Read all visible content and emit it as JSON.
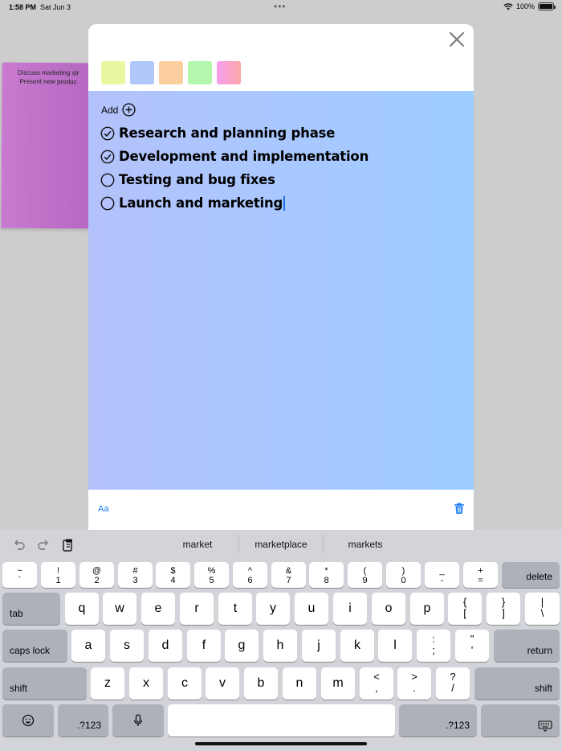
{
  "status_bar": {
    "time": "1:58 PM",
    "date": "Sat Jun 3",
    "battery": "100%"
  },
  "background_note": {
    "lines": [
      "Discuss marketing str",
      "Present new produc"
    ]
  },
  "modal": {
    "swatch_colors": [
      "#e9f8a0",
      "#b0c7fb",
      "#fccf9f",
      "#b5f7ae",
      "#f6a0f0"
    ],
    "add_label": "Add",
    "checklist": [
      {
        "text": "Research and planning phase",
        "checked": true
      },
      {
        "text": "Development and implementation",
        "checked": true
      },
      {
        "text": "Testing and bug fixes",
        "checked": false
      },
      {
        "text": "Launch and marketing",
        "checked": false
      }
    ],
    "format_label": "Aa"
  },
  "keyboard": {
    "suggestions": [
      "market",
      "marketplace",
      "markets"
    ],
    "number_row": [
      {
        "top": "~",
        "bot": "`"
      },
      {
        "top": "!",
        "bot": "1"
      },
      {
        "top": "@",
        "bot": "2"
      },
      {
        "top": "#",
        "bot": "3"
      },
      {
        "top": "$",
        "bot": "4"
      },
      {
        "top": "%",
        "bot": "5"
      },
      {
        "top": "^",
        "bot": "6"
      },
      {
        "top": "&",
        "bot": "7"
      },
      {
        "top": "*",
        "bot": "8"
      },
      {
        "top": "(",
        "bot": "9"
      },
      {
        "top": ")",
        "bot": "0"
      },
      {
        "top": "_",
        "bot": "-"
      },
      {
        "top": "+",
        "bot": "="
      }
    ],
    "delete_label": "delete",
    "tab_label": "tab",
    "row_q": [
      "q",
      "w",
      "e",
      "r",
      "t",
      "y",
      "u",
      "i",
      "o",
      "p"
    ],
    "row_q_symbols": [
      {
        "top": "{",
        "bot": "["
      },
      {
        "top": "}",
        "bot": "]"
      },
      {
        "top": "|",
        "bot": "\\"
      }
    ],
    "caps_label": "caps lock",
    "row_a": [
      "a",
      "s",
      "d",
      "f",
      "g",
      "h",
      "j",
      "k",
      "l"
    ],
    "row_a_symbols": [
      {
        "top": ":",
        "bot": ";"
      },
      {
        "top": "\"",
        "bot": "'"
      }
    ],
    "return_label": "return",
    "shift_label": "shift",
    "row_z": [
      "z",
      "x",
      "c",
      "v",
      "b",
      "n",
      "m"
    ],
    "row_z_symbols": [
      {
        "top": "<",
        "bot": ","
      },
      {
        "top": ">",
        "bot": "."
      },
      {
        "top": "?",
        "bot": "/"
      }
    ],
    "numbers_label": ".?123"
  }
}
